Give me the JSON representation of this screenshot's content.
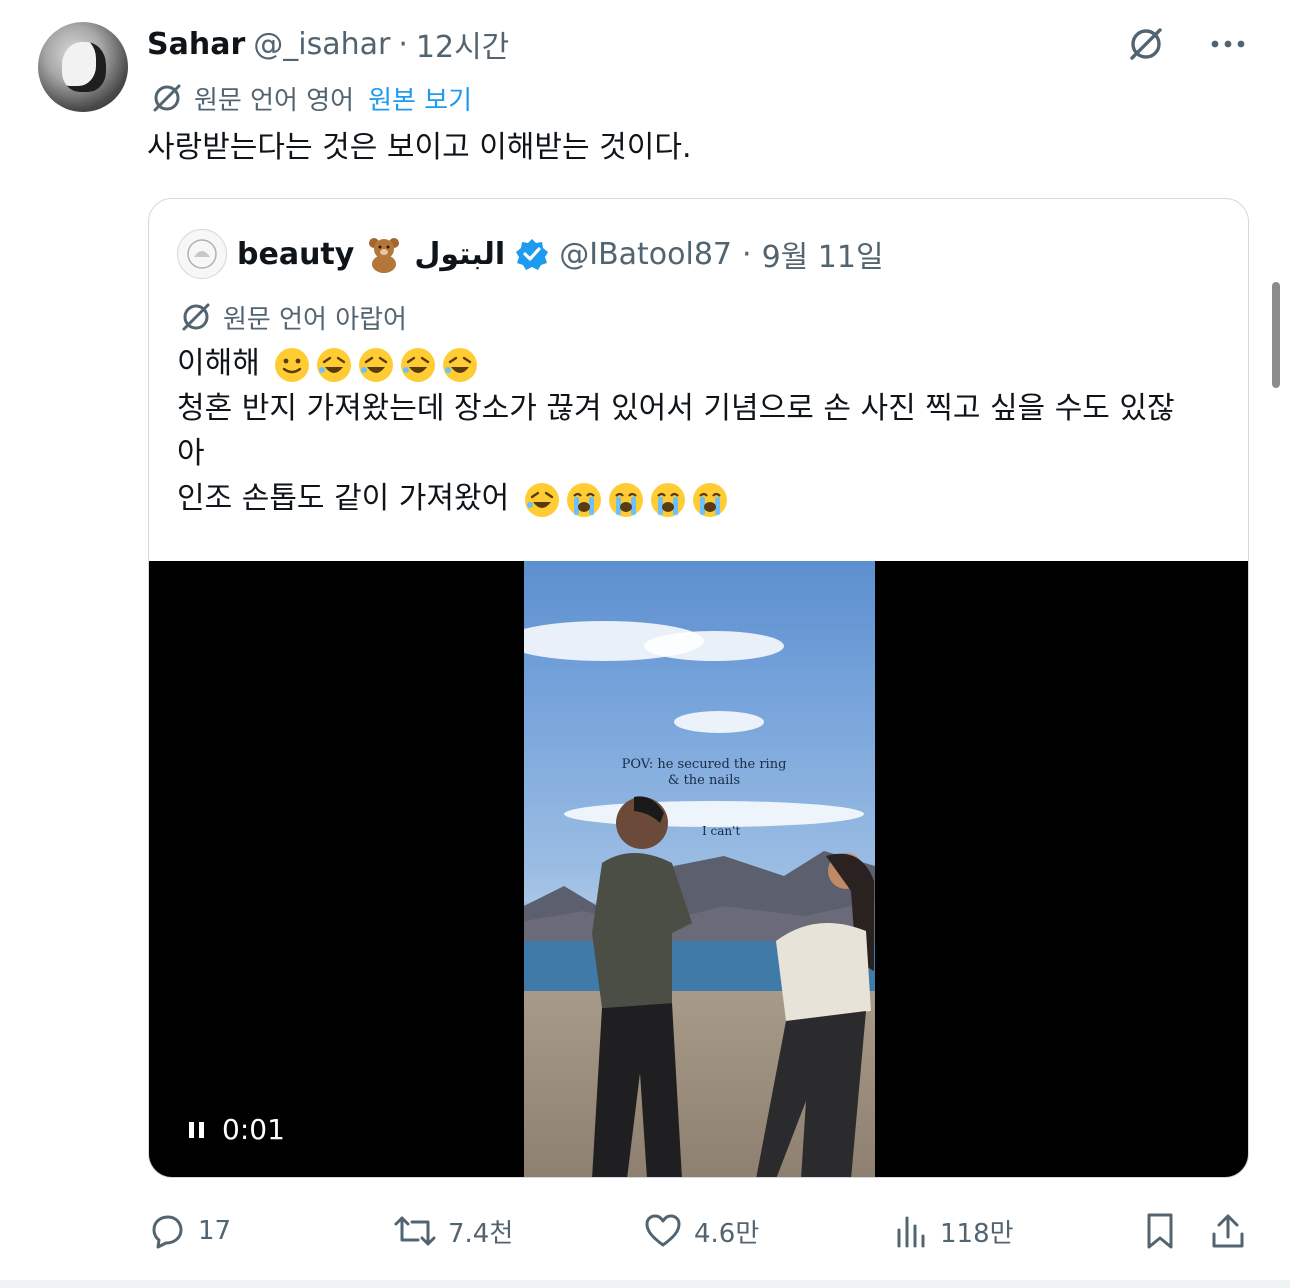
{
  "post": {
    "author_name": "Sahar",
    "author_handle": "@_isahar",
    "separator": "·",
    "time": "12시간",
    "translate_label": "원문 언어 영어",
    "translate_link": "원본 보기",
    "text": "사랑받는다는 것은 보이고 이해받는 것이다."
  },
  "quote": {
    "author_name": "beauty",
    "author_name_arabic": "البتول",
    "author_handle": "@IBatool87",
    "separator": "·",
    "date": "9월 11일",
    "translate_label": "원문 언어 아랍어",
    "line1": "이해해",
    "line2": "청혼 반지 가져왔는데 장소가 끊겨 있어서 기념으로 손 사진 찍고 싶을 수도 있잖",
    "line3": "아",
    "line4": "인조 손톱도 같이 가져왔어",
    "video": {
      "overlay_line1": "POV: he secured the ring",
      "overlay_line2": "& the nails",
      "overlay_line3": "I can't",
      "timestamp": "0:01"
    }
  },
  "actions": {
    "replies": "17",
    "reposts": "7.4천",
    "likes": "4.6만",
    "views": "118만"
  },
  "colors": {
    "text_primary": "#0f1419",
    "text_secondary": "#536471",
    "link": "#1d9bf0",
    "border": "#cfd9de",
    "verified": "#1d9bf0"
  },
  "icons": [
    "grok-slash-icon",
    "more-icon",
    "translate-icon",
    "verified-badge-icon",
    "pause-icon",
    "reply-icon",
    "repost-icon",
    "like-icon",
    "views-icon",
    "bookmark-icon",
    "share-icon"
  ]
}
